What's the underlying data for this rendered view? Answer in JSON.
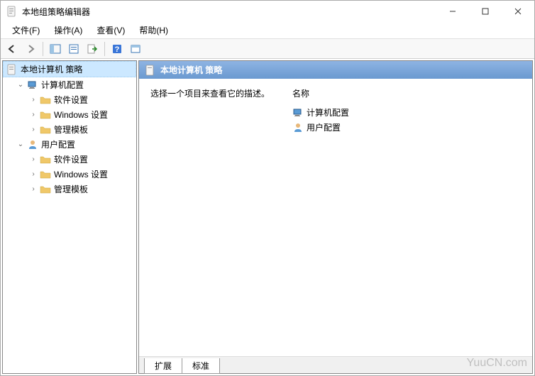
{
  "window": {
    "title": "本地组策略编辑器"
  },
  "menu": {
    "file": "文件(F)",
    "action": "操作(A)",
    "view": "查看(V)",
    "help": "帮助(H)"
  },
  "tree": {
    "root": "本地计算机 策略",
    "computer_config": "计算机配置",
    "computer_software": "软件设置",
    "computer_windows": "Windows 设置",
    "computer_templates": "管理模板",
    "user_config": "用户配置",
    "user_software": "软件设置",
    "user_windows": "Windows 设置",
    "user_templates": "管理模板"
  },
  "main": {
    "header": "本地计算机 策略",
    "description": "选择一个项目来查看它的描述。",
    "name_column": "名称",
    "item_computer": "计算机配置",
    "item_user": "用户配置"
  },
  "tabs": {
    "extended": "扩展",
    "standard": "标准"
  },
  "watermark": "YuuCN.com"
}
